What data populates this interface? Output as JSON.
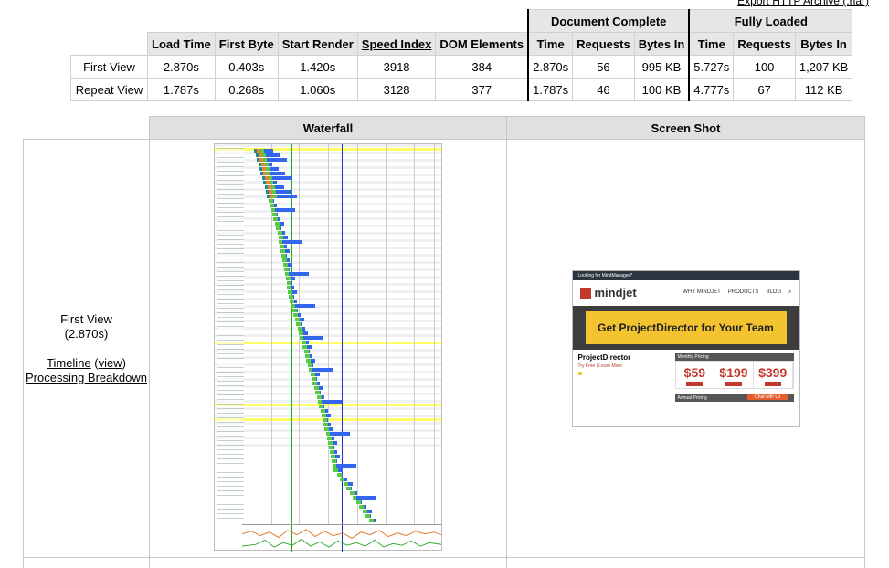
{
  "export_link": "Export HTTP Archive (.har)",
  "summary": {
    "columns": [
      "Load Time",
      "First Byte",
      "Start Render",
      "Speed Index",
      "DOM Elements"
    ],
    "groups": {
      "doc_complete": "Document Complete",
      "fully_loaded": "Fully Loaded"
    },
    "group_cols": [
      "Time",
      "Requests",
      "Bytes In"
    ],
    "rows": [
      {
        "label": "First View",
        "load_time": "2.870s",
        "first_byte": "0.403s",
        "start_render": "1.420s",
        "speed_index": "3918",
        "dom_elements": "384",
        "dc_time": "2.870s",
        "dc_requests": "56",
        "dc_bytes": "995 KB",
        "fl_time": "5.727s",
        "fl_requests": "100",
        "fl_bytes": "1,207 KB"
      },
      {
        "label": "Repeat View",
        "load_time": "1.787s",
        "first_byte": "0.268s",
        "start_render": "1.060s",
        "speed_index": "3128",
        "dom_elements": "377",
        "dc_time": "1.787s",
        "dc_requests": "46",
        "dc_bytes": "100 KB",
        "fl_time": "4.777s",
        "fl_requests": "67",
        "fl_bytes": "112 KB"
      }
    ]
  },
  "details": {
    "waterfall_header": "Waterfall",
    "screenshot_header": "Screen Shot",
    "first_view_label": "First View",
    "first_view_time": "(2.870s)",
    "timeline_link": "Timeline",
    "view_link": "view",
    "processing_link": "Processing Breakdown"
  },
  "screenshot": {
    "top_bar": "Looking for MindManager?",
    "logo": "mindjet",
    "nav": [
      "WHY MINDJET",
      "PRODUCTS",
      "BLOG"
    ],
    "hero": "Get ProjectDirector for Your Team",
    "product": "ProjectDirector",
    "sub": "Try Free | Learn More",
    "monthly": "Monthly Pricing",
    "prices": [
      "$59",
      "$199",
      "$399"
    ],
    "annual": "Annual Pricing",
    "chat": "Chat with Us"
  },
  "colors": {
    "start_render": "#22aa22",
    "doc_complete": "#2233cc",
    "highlight": "#ffff66",
    "dns": "#1a8f8f",
    "connect": "#f08030",
    "ttfb": "#55cc44",
    "download": "#3366ee",
    "cpu": "#e0782a"
  }
}
